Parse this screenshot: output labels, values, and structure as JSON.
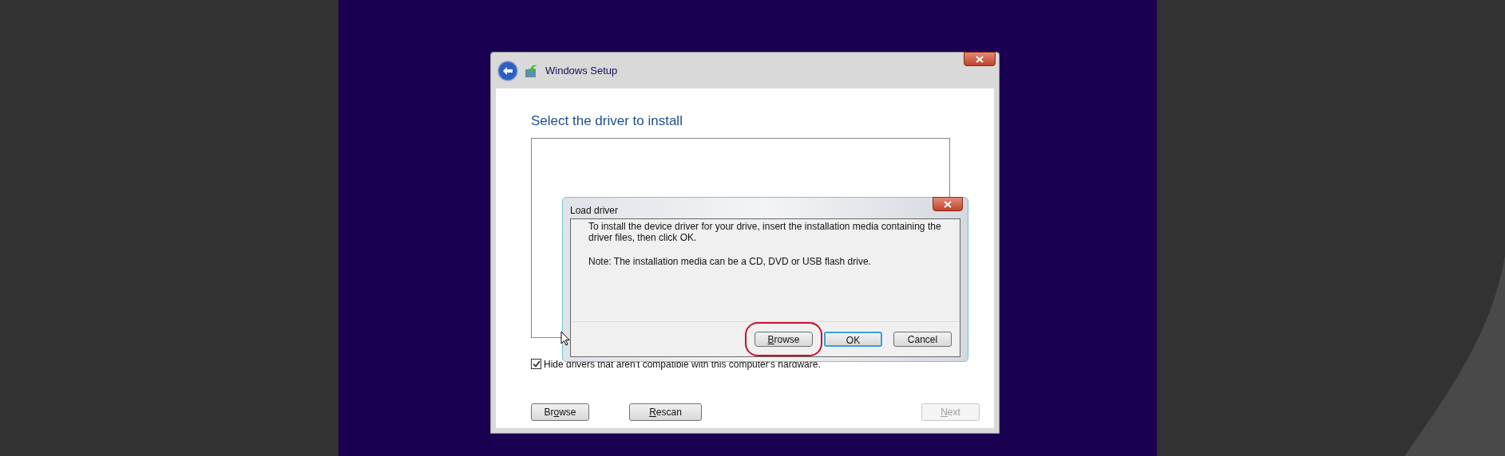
{
  "window": {
    "title": "Windows Setup",
    "heading": "Select the driver to install"
  },
  "hide_incompatible": {
    "label": "Hide drivers that aren't compatible with this computer's hardware.",
    "checked": true
  },
  "buttons": [
    {
      "before": "Br",
      "key": "o",
      "after": "wse",
      "disabled": false
    },
    {
      "key": "R",
      "after": "escan",
      "disabled": false
    },
    {
      "key": "N",
      "after": "ext",
      "disabled": true
    }
  ],
  "dialog": {
    "title": "Load driver",
    "message": "To install the device driver for your drive, insert the installation media containing the driver files, then click OK.",
    "note": "Note: The installation media can be a CD, DVD or USB flash drive.",
    "buttons": [
      {
        "key": "B",
        "after": "rowse",
        "focused": false,
        "highlighted": true
      },
      {
        "before": "OK",
        "focused": true,
        "highlighted": false
      },
      {
        "before": "Cancel",
        "focused": false,
        "highlighted": false
      }
    ]
  }
}
